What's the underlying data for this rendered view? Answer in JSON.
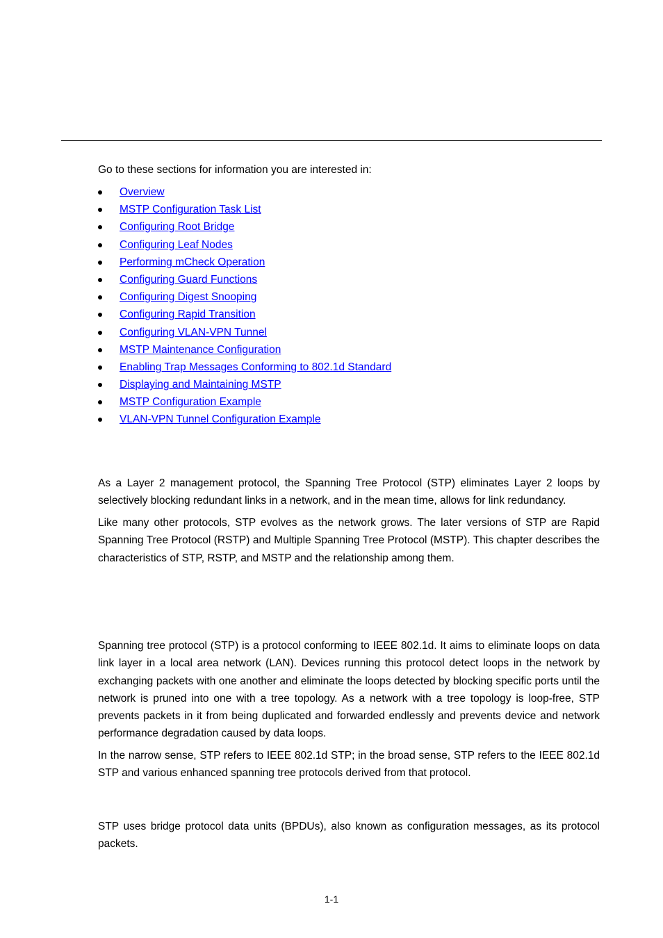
{
  "intro": "Go to these sections for information you are interested in:",
  "toc": [
    {
      "label": "Overview"
    },
    {
      "label": "MSTP Configuration Task List"
    },
    {
      "label": "Configuring Root Bridge"
    },
    {
      "label": "Configuring Leaf Nodes"
    },
    {
      "label": "Performing mCheck Operation"
    },
    {
      "label": "Configuring Guard Functions"
    },
    {
      "label": "Configuring Digest Snooping"
    },
    {
      "label": "Configuring Rapid Transition"
    },
    {
      "label": "Configuring VLAN-VPN Tunnel"
    },
    {
      "label": "MSTP Maintenance Configuration"
    },
    {
      "label": "Enabling Trap Messages Conforming to 802.1d Standard"
    },
    {
      "label": "Displaying and Maintaining MSTP"
    },
    {
      "label": "MSTP Configuration Example"
    },
    {
      "label": "VLAN-VPN Tunnel Configuration Example"
    }
  ],
  "paragraphs": [
    "As a Layer 2 management protocol, the Spanning Tree Protocol (STP) eliminates Layer 2 loops by selectively blocking redundant links in a network, and in the mean time, allows for link redundancy.",
    "Like many other protocols, STP evolves as the network grows. The later versions of STP are Rapid Spanning Tree Protocol (RSTP) and Multiple Spanning Tree Protocol (MSTP). This chapter describes the characteristics of STP, RSTP, and MSTP and the relationship among them.",
    "Spanning tree protocol (STP) is a protocol conforming to IEEE 802.1d. It aims to eliminate loops on data link layer in a local area network (LAN). Devices running this protocol detect loops in the network by exchanging packets with one another and eliminate the loops detected by blocking specific ports until the network is pruned into one with a tree topology. As a network with a tree topology is loop-free, STP prevents packets in it from being duplicated and forwarded endlessly and prevents device and network performance degradation caused by data loops.",
    "In the narrow sense, STP refers to IEEE 802.1d STP; in the broad sense, STP refers to the IEEE 802.1d STP and various enhanced spanning tree protocols derived from that protocol.",
    "STP uses bridge protocol data units (BPDUs), also known as configuration messages, as its protocol packets."
  ],
  "page_number": "1-1",
  "colors": {
    "link": "#0000ff",
    "text": "#000000"
  }
}
